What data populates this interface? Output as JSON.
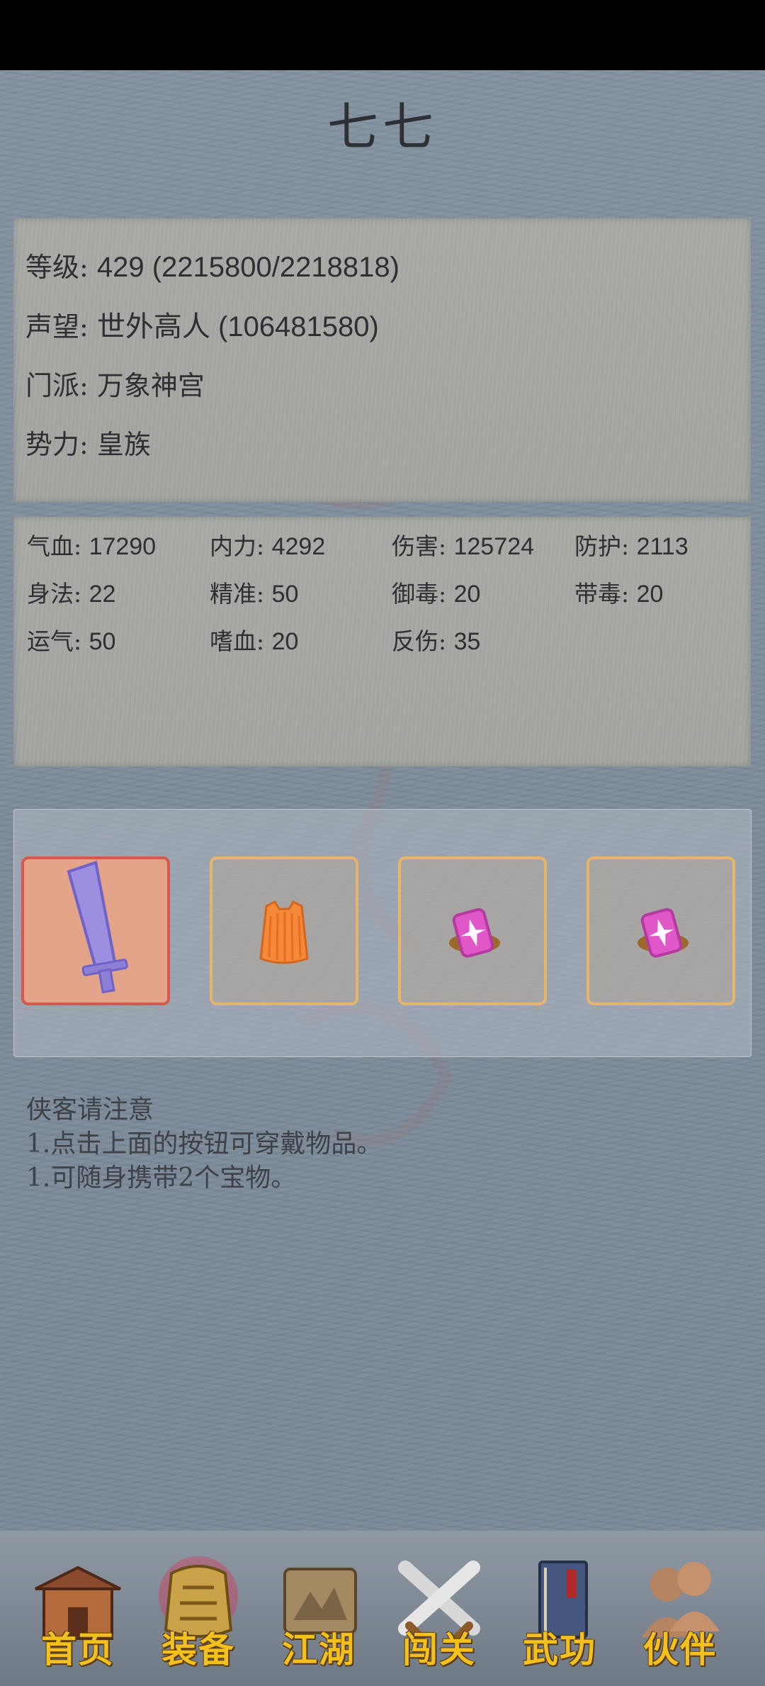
{
  "player": {
    "name": "七七",
    "level_label": "等级: ",
    "level_value": "429 (2215800/2218818)",
    "fame_label": "声望: ",
    "fame_value": "世外高人 (106481580)",
    "sect_label": "门派: ",
    "sect_value": "万象神宫",
    "faction_label": "势力: ",
    "faction_value": " 皇族"
  },
  "stats": [
    {
      "k": "气血: ",
      "v": "17290"
    },
    {
      "k": "内力: ",
      "v": "4292"
    },
    {
      "k": "伤害: ",
      "v": "125724"
    },
    {
      "k": "防护: ",
      "v": "2113"
    },
    {
      "k": "身法: ",
      "v": "22"
    },
    {
      "k": "精准: ",
      "v": "50"
    },
    {
      "k": "御毒: ",
      "v": "20"
    },
    {
      "k": "带毒: ",
      "v": "20"
    },
    {
      "k": "运气: ",
      "v": "50"
    },
    {
      "k": "嗜血: ",
      "v": "20"
    },
    {
      "k": "反伤: ",
      "v": "35"
    }
  ],
  "equipment": {
    "slots": [
      {
        "icon": "sword-icon",
        "selected": true
      },
      {
        "icon": "robe-icon",
        "selected": false
      },
      {
        "icon": "gem-treasure-icon",
        "selected": false
      },
      {
        "icon": "gem-treasure-icon",
        "selected": false
      }
    ]
  },
  "notice": {
    "title": "侠客请注意",
    "line1": "1.点击上面的按钮可穿戴物品。",
    "line2": "1.可随身携带2个宝物。"
  },
  "nav": {
    "items": [
      {
        "label": "首页",
        "icon": "house-icon"
      },
      {
        "label": "装备",
        "icon": "armor-icon",
        "active": true
      },
      {
        "label": "江湖",
        "icon": "scroll-map-icon"
      },
      {
        "label": "闯关",
        "icon": "crossed-swords-icon"
      },
      {
        "label": "武功",
        "icon": "book-icon"
      },
      {
        "label": "伙伴",
        "icon": "companions-icon"
      }
    ]
  },
  "colors": {
    "accent_gold": "#f3c11d",
    "slot_border": "#e7b46b",
    "slot_selected_border": "#d6584e",
    "slot_selected_fill": "#e3a48a"
  }
}
